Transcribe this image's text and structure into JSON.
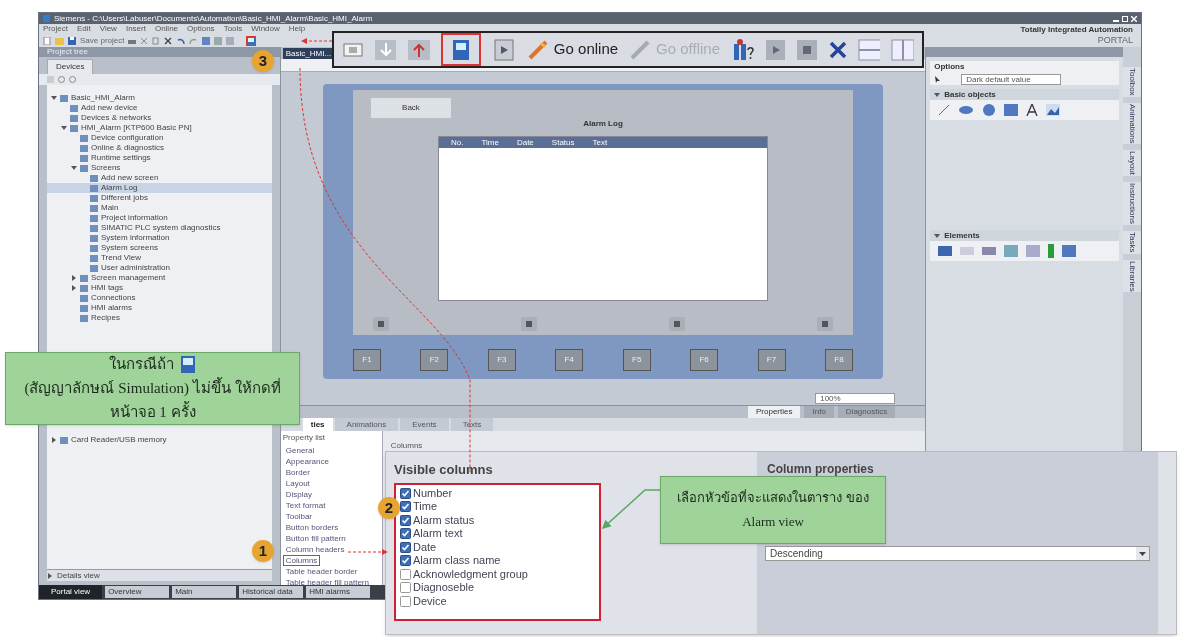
{
  "window": {
    "title": "Siemens - C:\\Users\\Labuser\\Documents\\Automation\\Basic_HMI_Alarm\\Basic_HMI_Alarm",
    "menu": [
      "Project",
      "Edit",
      "View",
      "Insert",
      "Online",
      "Options",
      "Tools",
      "Window",
      "Help"
    ],
    "save_label": "Save project",
    "brand": [
      "Totally Integrated Automation",
      "PORTAL"
    ]
  },
  "toolbar_callout": {
    "items": [
      {
        "kind": "compile"
      },
      {
        "kind": "download"
      },
      {
        "kind": "upload"
      },
      {
        "kind": "simulation",
        "selected": true
      },
      {
        "kind": "runtime",
        "selected": false
      },
      {
        "kind": "online",
        "label": "Go online",
        "disabled": false
      },
      {
        "kind": "offline",
        "label": "Go offline",
        "disabled": true
      },
      {
        "kind": "devices"
      },
      {
        "kind": "monitor"
      },
      {
        "kind": "stop"
      },
      {
        "kind": "cross"
      },
      {
        "kind": "split-horizontal"
      },
      {
        "kind": "split-vertical"
      }
    ]
  },
  "project_tree": {
    "title": "Project tree",
    "tabs": [
      {
        "label": "Devices",
        "selected": true
      }
    ],
    "items": [
      {
        "label": "Basic_HMI_Alarm",
        "expanded": true,
        "selected": false,
        "children": [
          {
            "label": "Add new device",
            "selected": false
          },
          {
            "label": "Devices & networks",
            "selected": false
          },
          {
            "label": "HMI_Alarm [KTP600 Basic PN]",
            "expanded": true,
            "selected": false,
            "children": [
              {
                "label": "Device configuration",
                "selected": false
              },
              {
                "label": "Online & diagnostics",
                "selected": false
              },
              {
                "label": "Runtime settings",
                "selected": false
              },
              {
                "label": "Screens",
                "expanded": true,
                "selected": false,
                "children": [
                  {
                    "label": "Add new screen",
                    "selected": false
                  },
                  {
                    "label": "Alarm Log",
                    "selected": true
                  },
                  {
                    "label": "Different jobs",
                    "selected": false
                  },
                  {
                    "label": "Main",
                    "selected": false
                  },
                  {
                    "label": "Project information",
                    "selected": false
                  },
                  {
                    "label": "SIMATIC PLC system diagnostics",
                    "selected": false
                  },
                  {
                    "label": "System information",
                    "selected": false
                  },
                  {
                    "label": "System screens",
                    "selected": false
                  },
                  {
                    "label": "Trend View",
                    "selected": false
                  },
                  {
                    "label": "User administration",
                    "selected": false
                  }
                ]
              },
              {
                "label": "Screen management",
                "expanded": false,
                "selected": false
              },
              {
                "label": "HMI tags",
                "expanded": false,
                "selected": false
              },
              {
                "label": "Connections",
                "selected": false
              },
              {
                "label": "HMI alarms",
                "selected": false
              },
              {
                "label": "Recipes",
                "selected": false
              }
            ]
          }
        ]
      },
      {
        "label": "Card Reader/USB memory",
        "expanded": false,
        "selected": false
      }
    ],
    "details_view": "Details view"
  },
  "editor": {
    "tab": "Basic_HMI...",
    "screen": {
      "back": "Back",
      "title": "Alarm Log",
      "columns": [
        "No.",
        "Time",
        "Date",
        "Status",
        "Text"
      ],
      "function_keys": [
        "F1",
        "F2",
        "F3",
        "F4",
        "F5",
        "F6",
        "F7",
        "F8"
      ]
    },
    "zoom": "100%"
  },
  "inspector": {
    "panel_tabs": [
      {
        "label": "Properties",
        "selected": true
      },
      {
        "label": "Info",
        "selected": false
      },
      {
        "label": "Diagnostics",
        "selected": false
      }
    ],
    "tabs": [
      {
        "label": "ties",
        "selected": true
      },
      {
        "label": "Animations",
        "selected": false
      },
      {
        "label": "Events",
        "selected": false
      },
      {
        "label": "Texts",
        "selected": false
      }
    ],
    "property_list_title": "Property list",
    "properties": [
      {
        "label": "General",
        "selected": false
      },
      {
        "label": "Appearance",
        "selected": false
      },
      {
        "label": "Border",
        "selected": false
      },
      {
        "label": "Layout",
        "selected": false
      },
      {
        "label": "Display",
        "selected": false
      },
      {
        "label": "Text format",
        "selected": false
      },
      {
        "label": "Toolbar",
        "selected": false
      },
      {
        "label": "Button borders",
        "selected": false
      },
      {
        "label": "Button fill pattern",
        "selected": false
      },
      {
        "label": "Column headers",
        "selected": false
      },
      {
        "label": "Columns",
        "selected": true
      },
      {
        "label": "Table header border",
        "selected": false
      },
      {
        "label": "Table header fill pattern",
        "selected": false
      }
    ],
    "breadcrumb": "Columns"
  },
  "columns_panel": {
    "heading": "Visible columns",
    "columns": [
      {
        "label": "Number",
        "checked": true
      },
      {
        "label": "Time",
        "checked": true
      },
      {
        "label": "Alarm status",
        "checked": true
      },
      {
        "label": "Alarm text",
        "checked": true
      },
      {
        "label": "Date",
        "checked": true
      },
      {
        "label": "Alarm class name",
        "checked": true
      },
      {
        "label": "Acknowledgment group",
        "checked": false
      },
      {
        "label": "Diagnoseble",
        "checked": false
      },
      {
        "label": "Device",
        "checked": false
      }
    ],
    "properties_heading": "Column properties",
    "sort_value": "Descending"
  },
  "task_cards": {
    "options_title": "Options",
    "filter": "Dark default value",
    "sections": [
      {
        "title": "Basic objects",
        "expanded": true,
        "kind": "basic"
      },
      {
        "title": "Elements",
        "expanded": true,
        "kind": "elements"
      }
    ],
    "side_tabs": [
      "Toolbox",
      "Animations",
      "Layout",
      "Instructions",
      "Tasks",
      "Libraries"
    ]
  },
  "taskbar": {
    "portal_view": "Portal view",
    "items": [
      "Overview",
      "Main",
      "Historical data",
      "HMI alarms"
    ]
  },
  "annotations": {
    "simulation_note": {
      "before": "ในกรณีถ้า",
      "after": "(สัญญาลักษณ์ Simulation) ไม่ขึ้น ให้กดที่หน้าจอ 1 ครั้ง"
    },
    "columns_note": [
      "เลือกหัวข้อที่จะแสดงในตาราง",
      "ของ Alarm view"
    ],
    "badges": [
      "1",
      "2",
      "3"
    ]
  }
}
